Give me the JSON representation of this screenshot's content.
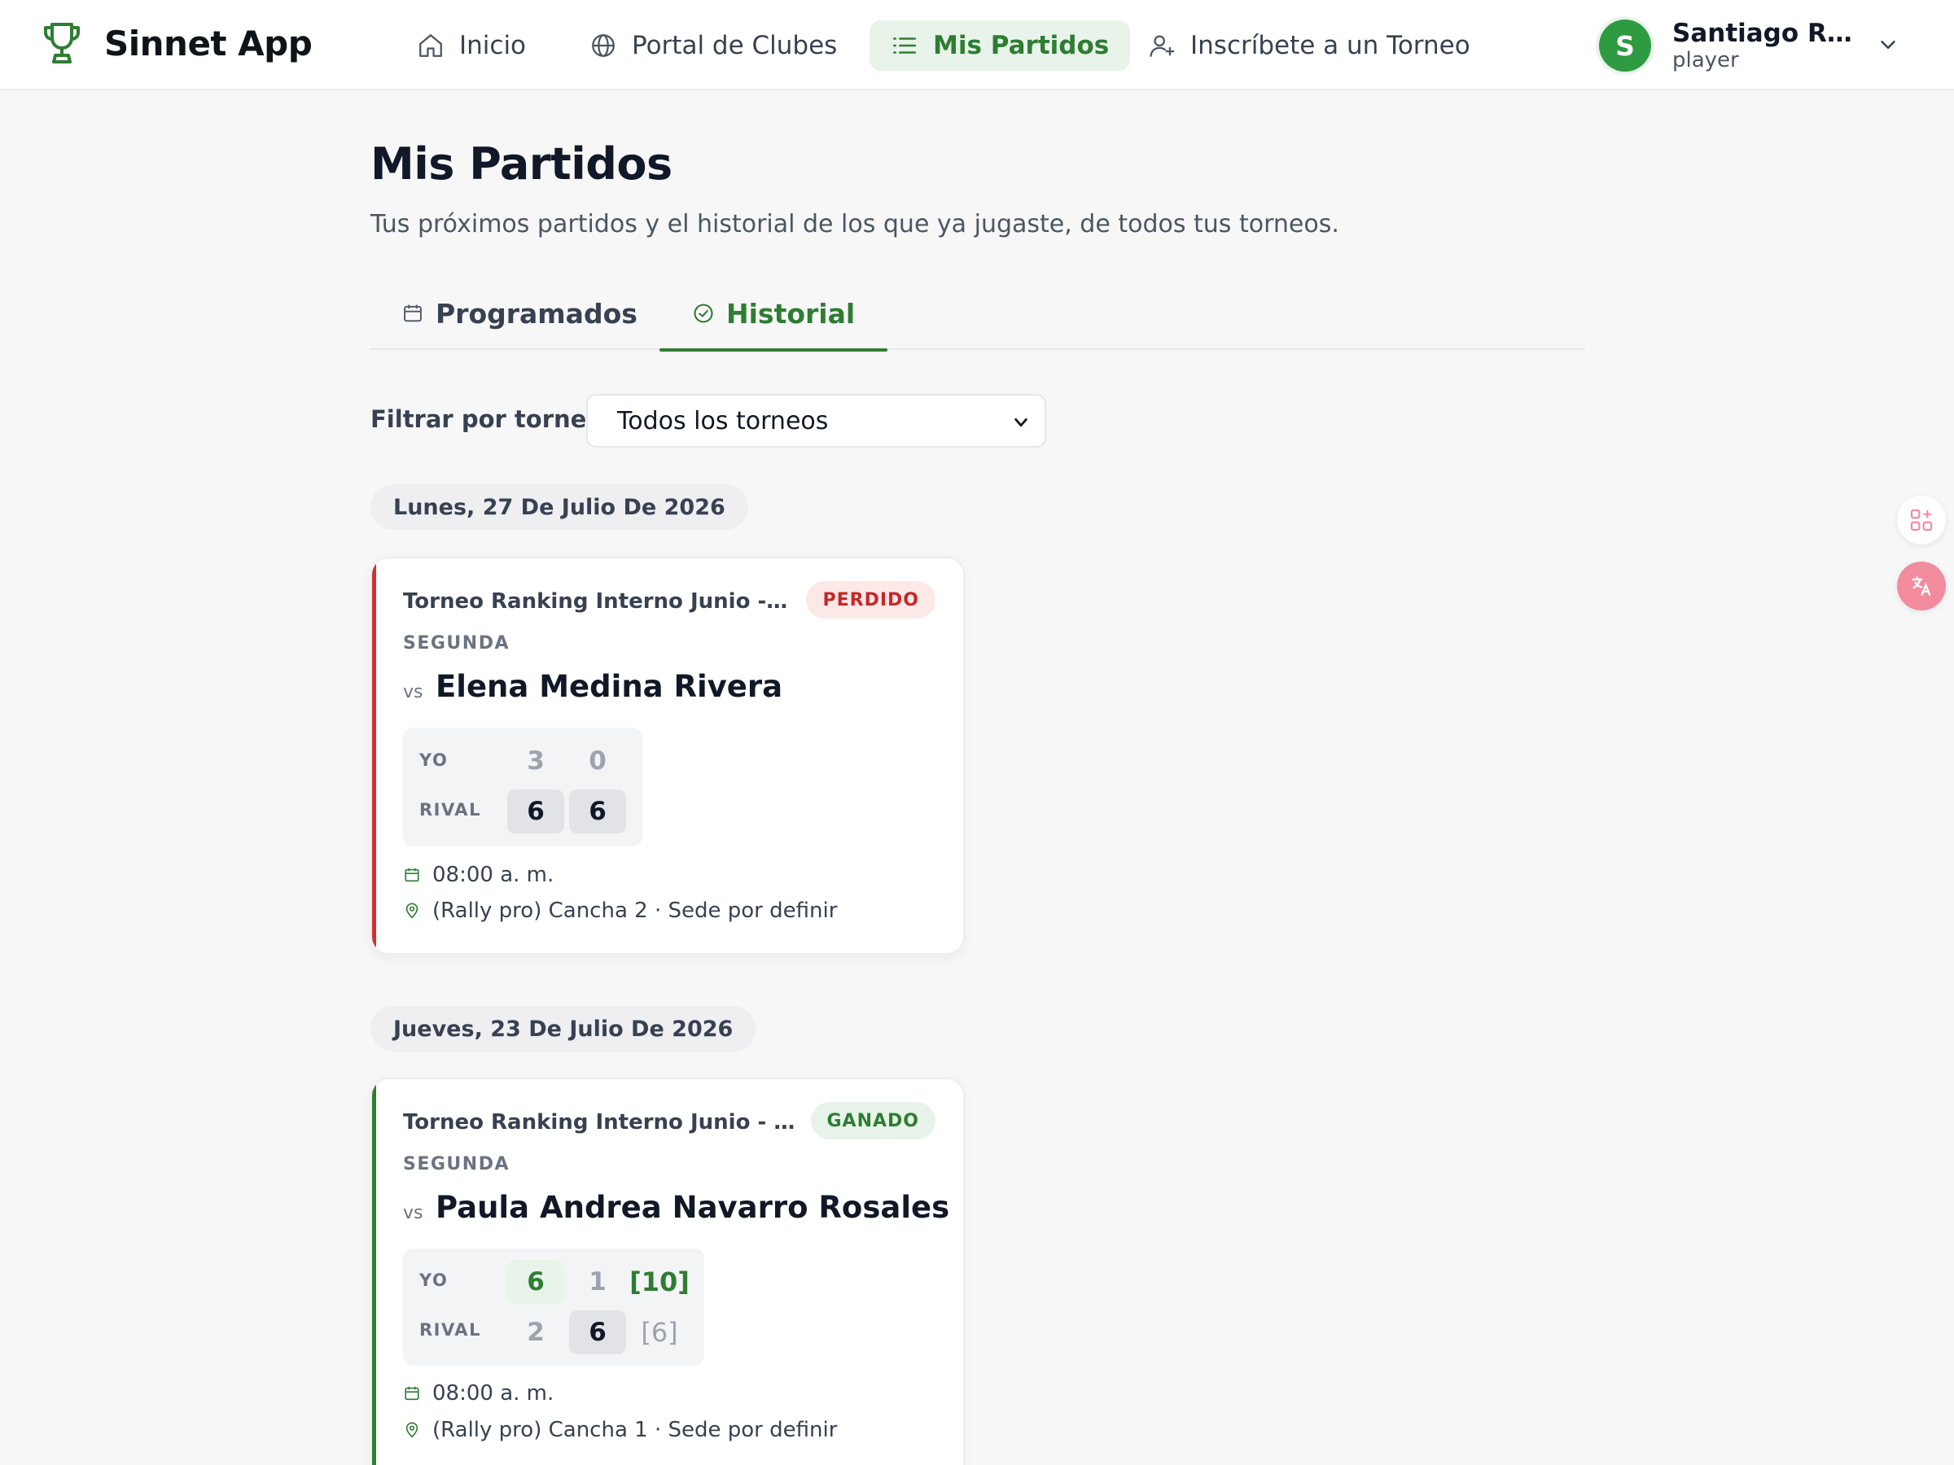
{
  "app": {
    "name": "Sinnet App",
    "logo_icon": "trophy-icon",
    "brand_color": "#2e7d32"
  },
  "nav": {
    "items": [
      {
        "label": "Inicio",
        "icon": "home-icon",
        "active": false
      },
      {
        "label": "Portal de Clubes",
        "icon": "globe-icon",
        "active": false
      },
      {
        "label": "Mis Partidos",
        "icon": "list-icon",
        "active": true
      },
      {
        "label": "Inscríbete a un Torneo",
        "icon": "user-plus-icon",
        "active": false
      }
    ]
  },
  "user": {
    "initial": "S",
    "name": "Santiago Ro...",
    "role": "player"
  },
  "page": {
    "title": "Mis Partidos",
    "subtitle": "Tus próximos partidos y el historial de los que ya jugaste, de todos tus torneos."
  },
  "tabs": [
    {
      "label": "Programados",
      "icon": "calendar-icon",
      "active": false
    },
    {
      "label": "Historial",
      "icon": "check-circle-icon",
      "active": true
    }
  ],
  "filter": {
    "label": "Filtrar por torneo",
    "selected": "Todos los torneos"
  },
  "groups": [
    {
      "date": "Lunes, 27 De Julio De 2026",
      "match": {
        "tournament": "Torneo Ranking Interno Junio - Rally pro",
        "status": "PERDIDO",
        "category": "SEGUNDA",
        "vs": "vs",
        "opponent": "Elena Medina Rivera",
        "me_label": "YO",
        "rival_label": "RIVAL",
        "me_scores": [
          "3",
          "0"
        ],
        "rival_scores": [
          "6",
          "6"
        ],
        "time": "08:00 a. m.",
        "location": "(Rally pro) Cancha 2 · Sede por definir"
      }
    },
    {
      "date": "Jueves, 23 De Julio De 2026",
      "match": {
        "tournament": "Torneo Ranking Interno Junio - Rally pro",
        "status": "GANADO",
        "category": "SEGUNDA",
        "vs": "vs",
        "opponent": "Paula Andrea Navarro Rosales",
        "me_label": "YO",
        "rival_label": "RIVAL",
        "me_scores": [
          "6",
          "1",
          "[10]"
        ],
        "rival_scores": [
          "2",
          "6",
          "[6]"
        ],
        "time": "08:00 a. m.",
        "location": "(Rally pro) Cancha 1 · Sede por definir"
      }
    }
  ],
  "colors": {
    "lost": "#d32f2f",
    "won": "#2e7d32"
  }
}
